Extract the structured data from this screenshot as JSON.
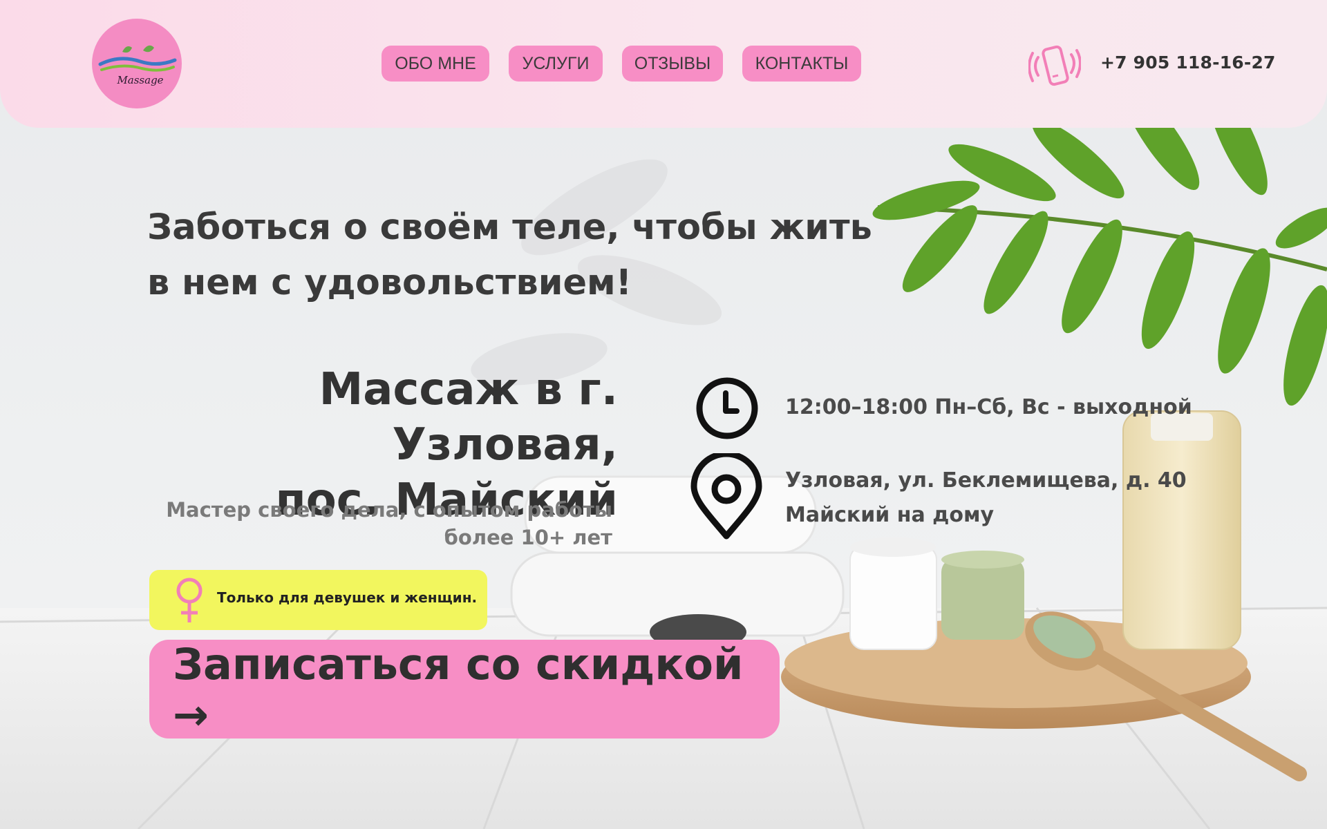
{
  "logo": {
    "text": "Massage",
    "color": "#f48cc3"
  },
  "nav": {
    "items": [
      {
        "label": "ОБО МНЕ"
      },
      {
        "label": "УСЛУГИ"
      },
      {
        "label": "ОТЗЫВЫ"
      },
      {
        "label": "КОНТАКТЫ"
      }
    ],
    "color": "#f78ec5"
  },
  "phone": {
    "icon": "phone-ringing-icon",
    "number": "+7 905 118-16-27"
  },
  "hero": {
    "tagline_line1": "Заботься о своём теле, чтобы жить",
    "tagline_line2": "в нем с удовольствием!",
    "title_line1": "Массаж в г. Узловая,",
    "title_line2": "пос. Майский",
    "subtitle_line1": "Мастер своего дела, с опытом работы",
    "subtitle_line2": "более 10+ лет"
  },
  "info": {
    "hours": {
      "icon": "clock-icon",
      "text": "12:00–18:00 Пн–Сб, Вс - выходной"
    },
    "address": {
      "icon": "location-pin-icon",
      "line1": "Узловая, ул. Беклемищева, д. 40",
      "line2": "Майский на дому"
    }
  },
  "badge": {
    "icon": "female-symbol-icon",
    "text": "Только для девушек и женщин.",
    "color": "#f2f65e"
  },
  "cta": {
    "label": "Записаться со скидкой →"
  }
}
